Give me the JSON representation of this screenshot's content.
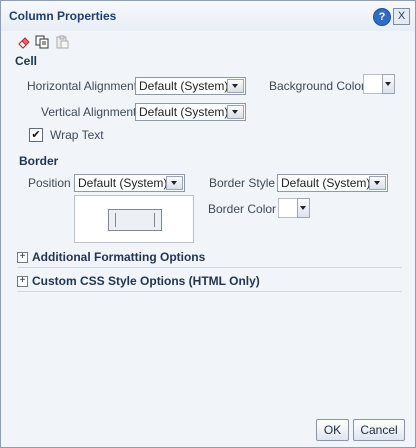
{
  "dialog": {
    "title": "Column Properties"
  },
  "cell": {
    "section_title": "Cell",
    "horizontal_alignment_label": "Horizontal Alignment",
    "horizontal_alignment_value": "Default (System)",
    "vertical_alignment_label": "Vertical Alignment",
    "vertical_alignment_value": "Default (System)",
    "background_color_label": "Background Color",
    "wrap_text_label": "Wrap Text",
    "wrap_text_checked": true,
    "check_mark": "✔"
  },
  "border": {
    "section_title": "Border",
    "position_label": "Position",
    "position_value": "Default (System)",
    "style_label": "Border Style",
    "style_value": "Default (System)",
    "color_label": "Border Color"
  },
  "sections": {
    "additional": "Additional Formatting Options",
    "custom_css": "Custom CSS Style Options (HTML Only)",
    "expand_glyph": "+"
  },
  "titlebar": {
    "help_glyph": "?",
    "close_glyph": "X"
  },
  "buttons": {
    "ok": "OK",
    "cancel": "Cancel"
  },
  "icons": [
    "eraser-icon",
    "copy-icon",
    "paste-icon"
  ],
  "colors": {
    "title": "#1c3f6e",
    "dialog_bg": "#f1f4f9",
    "help": "#2f6cc6"
  }
}
